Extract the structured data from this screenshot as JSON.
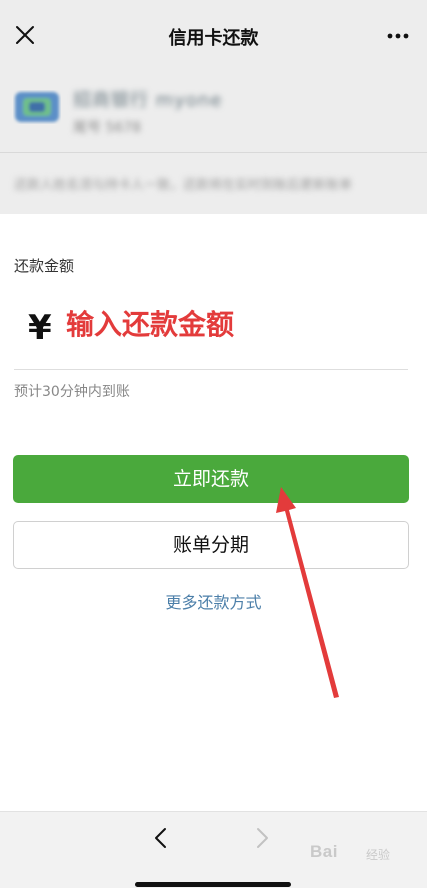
{
  "nav": {
    "title": "信用卡还款"
  },
  "card": {
    "bank_name": "招商银行 myone",
    "bank_sub": "尾号 5678",
    "note": "还款人姓名须与持卡人一致，还款将在实时到账后更新账单"
  },
  "amount": {
    "label": "还款金额",
    "currency": "¥",
    "placeholder": "输入还款金额",
    "arrival_note": "预计30分钟内到账"
  },
  "buttons": {
    "repay_now": "立即还款",
    "installment": "账单分期",
    "more_methods": "更多还款方式"
  },
  "watermark": {
    "brand": "Bai",
    "sub": "经验"
  },
  "colors": {
    "primary_green": "#4aa93c",
    "link_blue": "#4c7fa9",
    "annotation_red": "#e33b3b",
    "nav_gray": "#ededed"
  },
  "icons": {
    "close": "close-icon",
    "more": "more-dots-icon",
    "back": "chevron-left-icon",
    "forward": "chevron-right-icon",
    "bank_logo": "bank-logo-icon"
  }
}
